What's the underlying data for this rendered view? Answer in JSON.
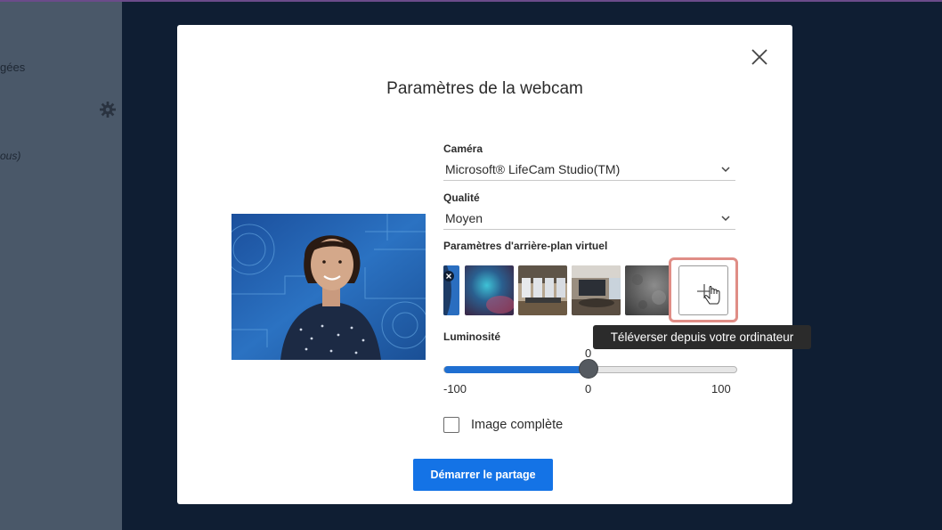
{
  "background": {
    "fragment_1": "gées",
    "fragment_2": "ous)"
  },
  "dialog": {
    "title": "Paramètres de la webcam",
    "camera": {
      "label": "Caméra",
      "value": "Microsoft® LifeCam Studio(TM)"
    },
    "quality": {
      "label": "Qualité",
      "value": "Moyen"
    },
    "virtual_background": {
      "label": "Paramètres d'arrière-plan virtuel",
      "thumbnails": [
        "none",
        "blur-color",
        "office",
        "conference-room",
        "texture"
      ],
      "upload_tooltip": "Téléverser depuis votre ordinateur"
    },
    "brightness": {
      "label": "Luminosité",
      "current": "0",
      "min": "-100",
      "mid": "0",
      "max": "100",
      "fill_fraction": 0.5
    },
    "full_image": {
      "label": "Image complète",
      "checked": false
    },
    "start_button": "Démarrer le partage"
  },
  "colors": {
    "accent": "#1473e6",
    "slider_fill": "#1f6fd1",
    "highlight": "#e08d86",
    "backdrop": "#0f1e33"
  },
  "icons": [
    "close-icon",
    "chevron-down-icon",
    "plus-icon",
    "hand-cursor-icon",
    "gear-icon"
  ]
}
